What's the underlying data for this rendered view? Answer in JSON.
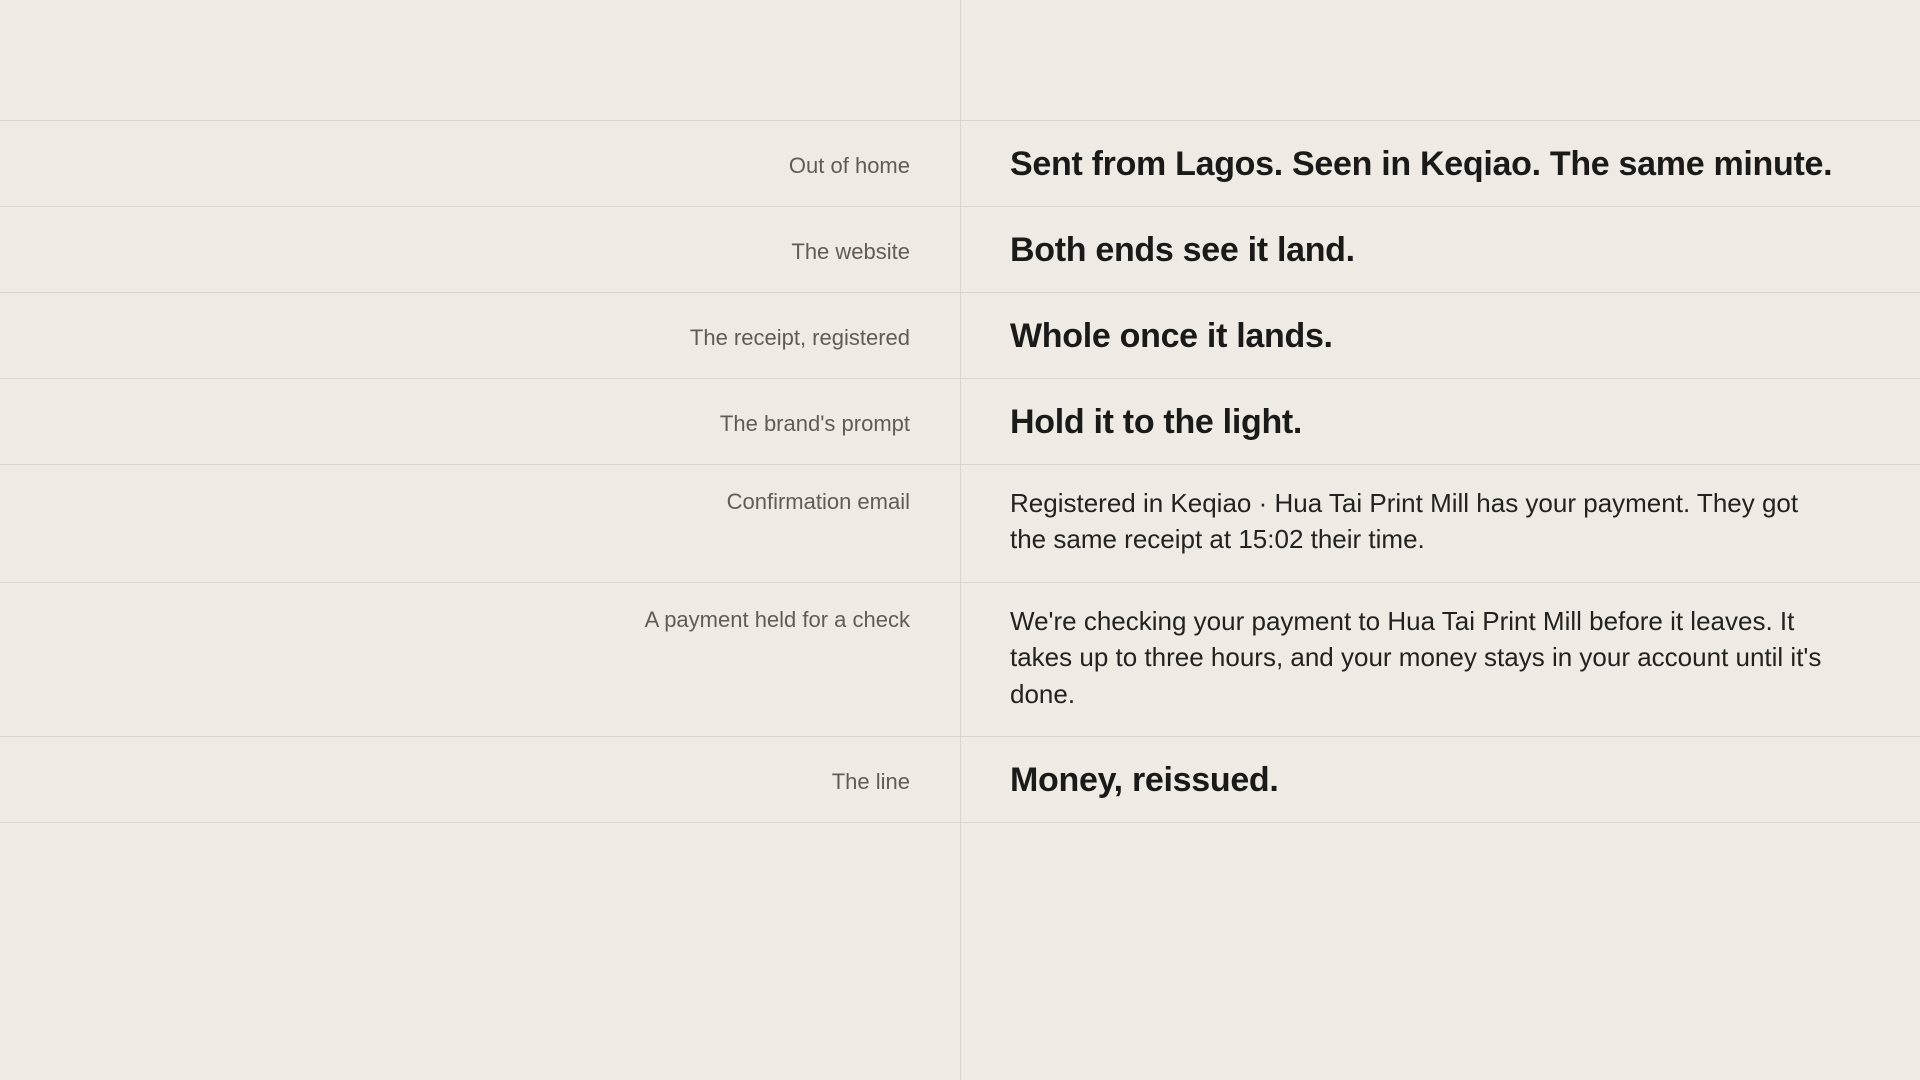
{
  "rows": [
    {
      "label": "Out of home",
      "value": "Sent from Lagos. Seen in Keqiao. The same minute.",
      "style": "headline"
    },
    {
      "label": "The website",
      "value": "Both ends see it land.",
      "style": "headline"
    },
    {
      "label": "The receipt, registered",
      "value": "Whole once it lands.",
      "style": "headline"
    },
    {
      "label": "The brand's prompt",
      "value": "Hold it to the light.",
      "style": "headline"
    },
    {
      "label": "Confirmation email",
      "value": "Registered in Keqiao · Hua Tai Print Mill has your payment. They got the same receipt at 15:02 their time.",
      "style": "body"
    },
    {
      "label": "A payment held for a check",
      "value": "We're checking your payment to Hua Tai Print Mill before it leaves. It takes up to three hours, and your money stays in your account until it's done.",
      "style": "body"
    },
    {
      "label": "The line",
      "value": "Money, reissued.",
      "style": "headline"
    }
  ]
}
